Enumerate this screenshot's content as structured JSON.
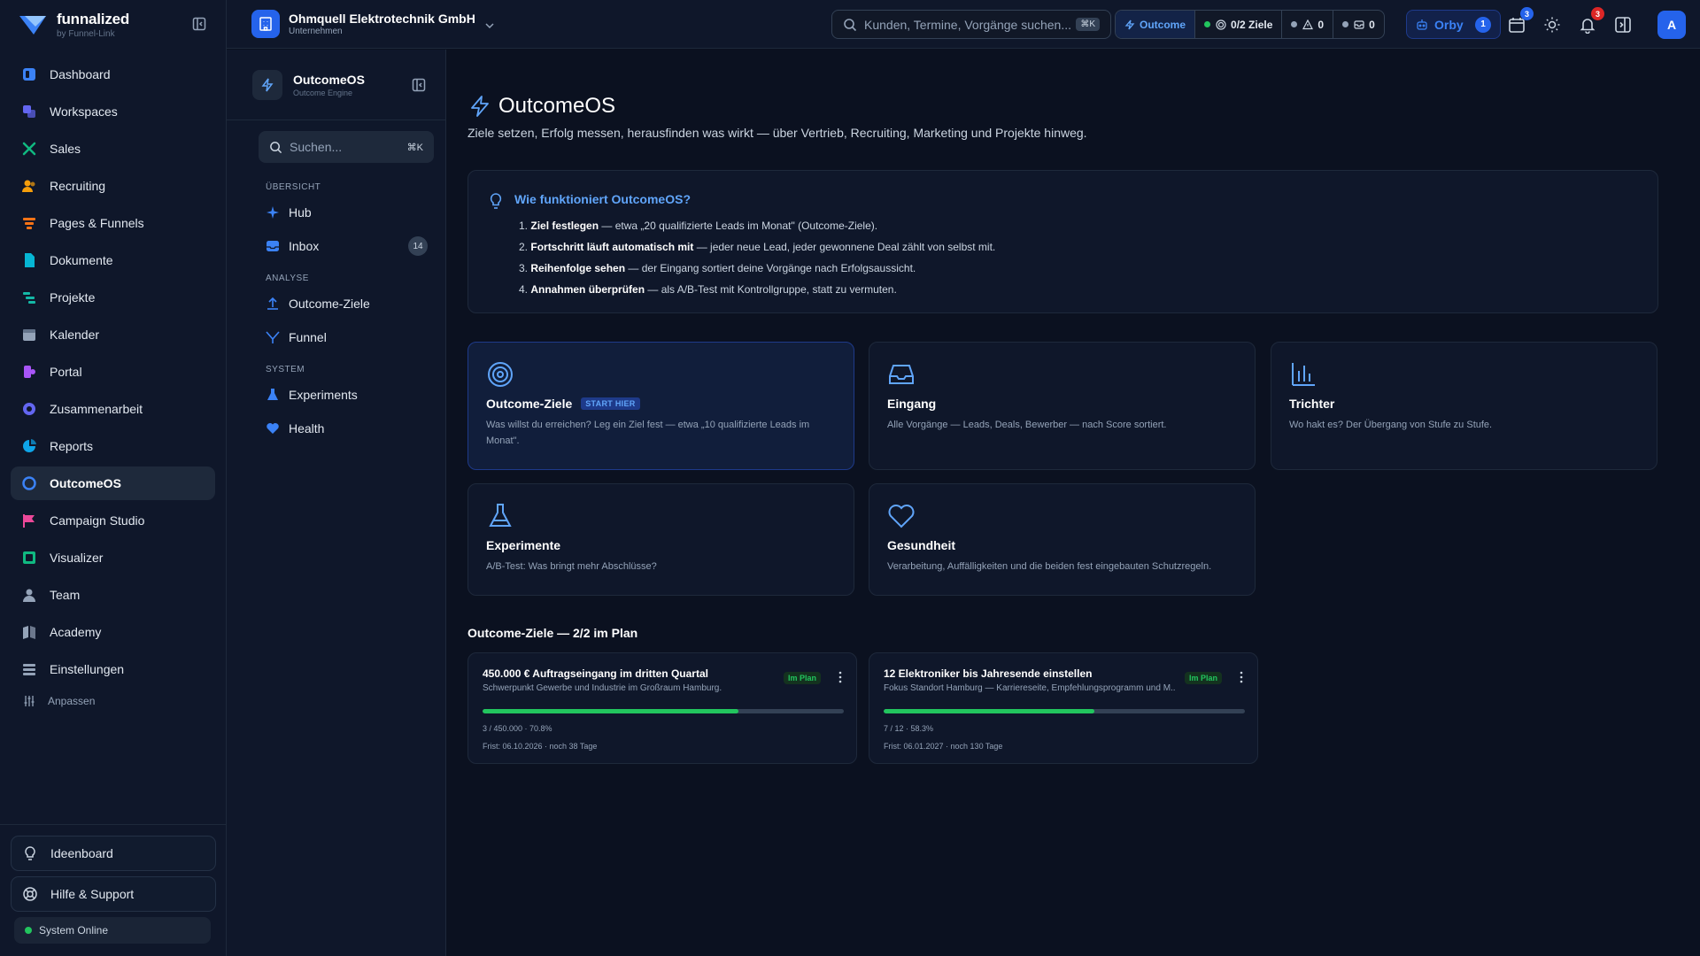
{
  "brand": {
    "name": "funnalized",
    "sub": "by Funnel-Link"
  },
  "sidebar": {
    "items": [
      {
        "label": "Dashboard",
        "icon": "dashboard-icon",
        "color": "#3b82f6"
      },
      {
        "label": "Workspaces",
        "icon": "workspaces-icon",
        "color": "#6366f1"
      },
      {
        "label": "Sales",
        "icon": "sales-icon",
        "color": "#10b981"
      },
      {
        "label": "Recruiting",
        "icon": "recruiting-icon",
        "color": "#f59e0b"
      },
      {
        "label": "Pages & Funnels",
        "icon": "pages-icon",
        "color": "#f97316"
      },
      {
        "label": "Dokumente",
        "icon": "documents-icon",
        "color": "#06b6d4"
      },
      {
        "label": "Projekte",
        "icon": "projects-icon",
        "color": "#14b8a6"
      },
      {
        "label": "Kalender",
        "icon": "calendar-icon",
        "color": "#94a3b8"
      },
      {
        "label": "Portal",
        "icon": "portal-icon",
        "color": "#a855f7"
      },
      {
        "label": "Zusammenarbeit",
        "icon": "collaboration-icon",
        "color": "#6366f1"
      },
      {
        "label": "Reports",
        "icon": "reports-icon",
        "color": "#0ea5e9"
      },
      {
        "label": "OutcomeOS",
        "icon": "outcomeos-icon",
        "color": "#3b82f6",
        "active": true
      },
      {
        "label": "Campaign Studio",
        "icon": "campaign-icon",
        "color": "#ec4899"
      },
      {
        "label": "Visualizer",
        "icon": "visualizer-icon",
        "color": "#10b981"
      },
      {
        "label": "Team",
        "icon": "team-icon",
        "color": "#94a3b8"
      },
      {
        "label": "Academy",
        "icon": "academy-icon",
        "color": "#94a3b8"
      },
      {
        "label": "Einstellungen",
        "icon": "settings-icon",
        "color": "#94a3b8"
      }
    ],
    "customize": "Anpassen",
    "ideaboard": "Ideenboard",
    "help": "Hilfe & Support",
    "status": "System Online"
  },
  "topbar": {
    "company_name": "Ohmquell Elektrotechnik GmbH",
    "company_type": "Unternehmen",
    "search_placeholder": "Kunden, Termine, Vorgänge suchen...",
    "search_kbd": "⌘K",
    "outcome_label": "Outcome",
    "goals_label": "0/2 Ziele",
    "warnings_count": "0",
    "messages_count": "0",
    "orby_label": "Orby",
    "orby_badge": "1",
    "calendar_badge": "3",
    "notifications_badge": "3",
    "avatar_initial": "A"
  },
  "subnav": {
    "title": "OutcomeOS",
    "subtitle": "Outcome Engine",
    "search_placeholder": "Suchen...",
    "search_kbd": "⌘K",
    "sections": {
      "overview": "ÜBERSICHT",
      "analysis": "ANALYSE",
      "system": "SYSTEM"
    },
    "hub": "Hub",
    "inbox": "Inbox",
    "inbox_count": "14",
    "outcome_goals": "Outcome-Ziele",
    "funnel": "Funnel",
    "experiments": "Experiments",
    "health": "Health"
  },
  "main": {
    "title": "OutcomeOS",
    "subtitle": "Ziele setzen, Erfolg messen, herausfinden was wirkt — über Vertrieb, Recruiting, Marketing und Projekte hinweg.",
    "info": {
      "title": "Wie funktioniert OutcomeOS?",
      "steps": [
        {
          "num": "1.",
          "bold": "Ziel festlegen",
          "text": " — etwa „20 qualifizierte Leads im Monat\" (Outcome-Ziele)."
        },
        {
          "num": "2.",
          "bold": "Fortschritt läuft automatisch mit",
          "text": " — jeder neue Lead, jeder gewonnene Deal zählt von selbst mit."
        },
        {
          "num": "3.",
          "bold": "Reihenfolge sehen",
          "text": " — der Eingang sortiert deine Vorgänge nach Erfolgsaussicht."
        },
        {
          "num": "4.",
          "bold": "Annahmen überprüfen",
          "text": " — als A/B-Test mit Kontrollgruppe, statt zu vermuten."
        }
      ]
    },
    "cards": [
      {
        "title": "Outcome-Ziele",
        "tag": "START HIER",
        "desc": "Was willst du erreichen? Leg ein Ziel fest — etwa „10 qualifizierte Leads im Monat\".",
        "icon": "target-icon"
      },
      {
        "title": "Eingang",
        "desc": "Alle Vorgänge — Leads, Deals, Bewerber — nach Score sortiert.",
        "icon": "inbox-tray-icon"
      },
      {
        "title": "Trichter",
        "desc": "Wo hakt es? Der Übergang von Stufe zu Stufe.",
        "icon": "bar-chart-icon"
      },
      {
        "title": "Experimente",
        "desc": "A/B-Test: Was bringt mehr Abschlüsse?",
        "icon": "flask-icon"
      },
      {
        "title": "Gesundheit",
        "desc": "Verarbeitung, Auffälligkeiten und die beiden fest eingebauten Schutzregeln.",
        "icon": "heart-icon"
      }
    ],
    "goals_title": "Outcome-Ziele — 2/2 im Plan",
    "goals": [
      {
        "title": "450.000 € Auftragseingang im dritten Quartal",
        "desc": "Schwerpunkt Gewerbe und Industrie im Großraum Hamburg.",
        "badge": "Im Plan",
        "progress": 70.8,
        "progress_text": "3 / 450.000 · 70.8%",
        "deadline": "Frist: 06.10.2026 · noch 38 Tage"
      },
      {
        "title": "12 Elektroniker bis Jahresende einstellen",
        "desc": "Fokus Standort Hamburg — Karriereseite, Empfehlungsprogramm und M...",
        "badge": "Im Plan",
        "progress": 58.3,
        "progress_text": "7 / 12 · 58.3%",
        "deadline": "Frist: 06.01.2027 · noch 130 Tage"
      }
    ]
  }
}
